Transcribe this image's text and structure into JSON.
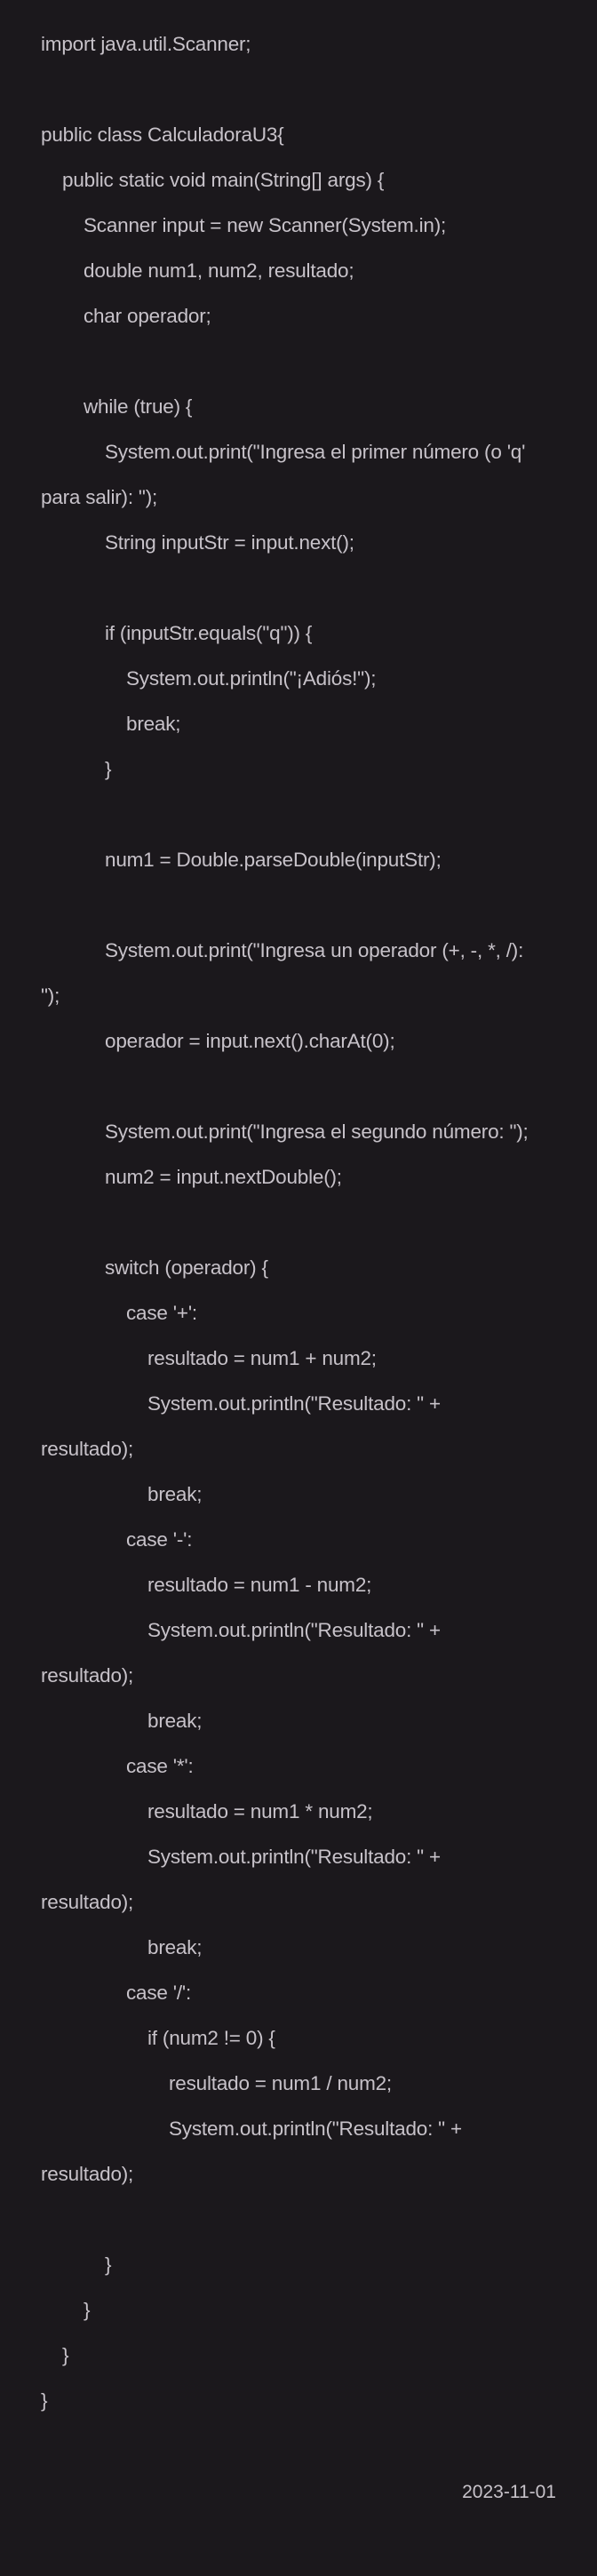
{
  "code_lines": [
    {
      "indent": 0,
      "text": "import java.util.Scanner;"
    },
    {
      "indent": 0,
      "text": ""
    },
    {
      "indent": 0,
      "text": "public class CalculadoraU3{"
    },
    {
      "indent": 1,
      "text": "public static void main(String[] args) {"
    },
    {
      "indent": 2,
      "text": "Scanner input = new Scanner(System.in);"
    },
    {
      "indent": 2,
      "text": "double num1, num2, resultado;"
    },
    {
      "indent": 2,
      "text": "char operador;"
    },
    {
      "indent": 0,
      "text": ""
    },
    {
      "indent": 2,
      "text": "while (true) {"
    },
    {
      "indent": 3,
      "text": "System.out.print(\"Ingresa el primer número (o 'q'"
    },
    {
      "indent": 0,
      "text": "para salir): \");"
    },
    {
      "indent": 3,
      "text": "String inputStr = input.next();"
    },
    {
      "indent": 0,
      "text": ""
    },
    {
      "indent": 3,
      "text": "if (inputStr.equals(\"q\")) {"
    },
    {
      "indent": 4,
      "text": "System.out.println(\"¡Adiós!\");"
    },
    {
      "indent": 4,
      "text": "break;"
    },
    {
      "indent": 3,
      "text": "}"
    },
    {
      "indent": 0,
      "text": ""
    },
    {
      "indent": 3,
      "text": "num1 = Double.parseDouble(inputStr);"
    },
    {
      "indent": 0,
      "text": ""
    },
    {
      "indent": 3,
      "text": "System.out.print(\"Ingresa un operador (+, -, *, /):"
    },
    {
      "indent": 0,
      "text": "\");"
    },
    {
      "indent": 3,
      "text": "operador = input.next().charAt(0);"
    },
    {
      "indent": 0,
      "text": ""
    },
    {
      "indent": 3,
      "text": "System.out.print(\"Ingresa el segundo número: \");"
    },
    {
      "indent": 3,
      "text": "num2 = input.nextDouble();"
    },
    {
      "indent": 0,
      "text": ""
    },
    {
      "indent": 3,
      "text": "switch (operador) {"
    },
    {
      "indent": 4,
      "text": "case '+':"
    },
    {
      "indent": 5,
      "text": "resultado = num1 + num2;"
    },
    {
      "indent": 5,
      "text": "System.out.println(\"Resultado: \" +"
    },
    {
      "indent": 0,
      "text": "resultado);"
    },
    {
      "indent": 5,
      "text": "break;"
    },
    {
      "indent": 4,
      "text": "case '-':"
    },
    {
      "indent": 5,
      "text": "resultado = num1 - num2;"
    },
    {
      "indent": 5,
      "text": "System.out.println(\"Resultado: \" +"
    },
    {
      "indent": 0,
      "text": "resultado);"
    },
    {
      "indent": 5,
      "text": "break;"
    },
    {
      "indent": 4,
      "text": "case '*':"
    },
    {
      "indent": 5,
      "text": "resultado = num1 * num2;"
    },
    {
      "indent": 5,
      "text": "System.out.println(\"Resultado: \" +"
    },
    {
      "indent": 0,
      "text": "resultado);"
    },
    {
      "indent": 5,
      "text": "break;"
    },
    {
      "indent": 4,
      "text": "case '/':"
    },
    {
      "indent": 5,
      "text": "if (num2 != 0) {"
    },
    {
      "indent": 6,
      "text": "resultado = num1 / num2;"
    },
    {
      "indent": 6,
      "text": "System.out.println(\"Resultado: \" +"
    },
    {
      "indent": 0,
      "text": "resultado);"
    },
    {
      "indent": 0,
      "text": ""
    },
    {
      "indent": 3,
      "text": "}"
    },
    {
      "indent": 2,
      "text": "}"
    },
    {
      "indent": 1,
      "text": "}"
    },
    {
      "indent": 0,
      "text": "}"
    }
  ],
  "footer": {
    "date": "2023-11-01"
  }
}
